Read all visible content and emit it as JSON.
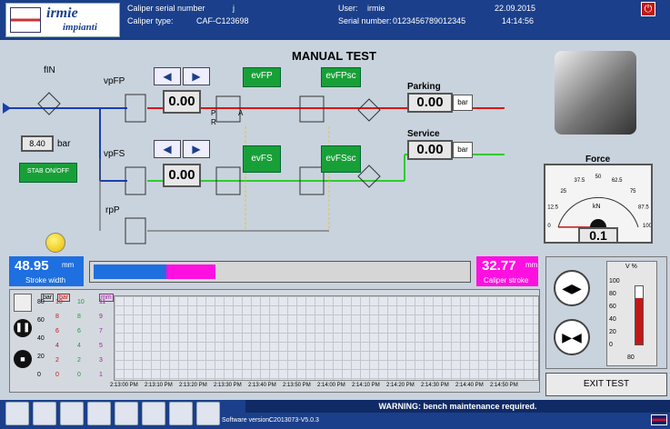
{
  "header": {
    "logo_text": "irmie",
    "logo_sub": "impianti",
    "caliper_serial_label": "Caliper serial number",
    "caliper_serial_value": "j",
    "caliper_type_label": "Caliper type:",
    "caliper_type_value": "CAF-C123698",
    "user_label": "User:",
    "user_value": "irmie",
    "serial_label": "Serial number:",
    "serial_value": "0123456789012345",
    "date": "22.09.2015",
    "time": "14:14:56"
  },
  "main": {
    "title": "MANUAL TEST",
    "fin_label": "fIN",
    "vpfp_label": "vpFP",
    "vpfs_label": "vpFS",
    "rpp_label": "rpP",
    "vpfp_value": "0.00",
    "vpfs_value": "0.00",
    "inlet_value": "8.40",
    "inlet_unit": "bar",
    "stab_button": "STAB ON/OFF",
    "evfp": "evFP",
    "evfpsc": "evFPsc",
    "evfs": "evFS",
    "evfssc": "evFSsc",
    "parking_label": "Parking",
    "parking_value": "0.00",
    "parking_unit": "bar",
    "service_label": "Service",
    "service_value": "0.00",
    "service_unit": "bar",
    "valve_p": "P",
    "valve_r": "R",
    "valve_a": "A"
  },
  "force": {
    "label": "Force",
    "ticks": [
      "0",
      "12.5",
      "25",
      "37.5",
      "50",
      "62.5",
      "75",
      "87.5",
      "100"
    ],
    "unit": "kN",
    "value": "0.1",
    "needle_fraction": 0.001
  },
  "stroke": {
    "width_value": "48.95",
    "width_unit": "mm",
    "width_label": "Stroke width",
    "caliper_value": "32.77",
    "caliper_unit": "mm",
    "caliper_label": "Caliper stroke"
  },
  "graph": {
    "axis_bar": "bar",
    "axis_bar2": "bar",
    "axis_mm": "mm",
    "y1_ticks": [
      "80",
      "60",
      "40",
      "20",
      "0"
    ],
    "y2_ticks": [
      "10",
      "8",
      "6",
      "4",
      "2",
      "0"
    ],
    "y3_ticks": [
      "10",
      "8",
      "6",
      "4",
      "2",
      "0"
    ],
    "y4_ticks": [
      "11",
      "9",
      "7",
      "5",
      "3",
      "1"
    ],
    "x_ticks": [
      "2:13:00 PM",
      "2:13:10 PM",
      "2:13:20 PM",
      "2:13:30 PM",
      "2:13:40 PM",
      "2:13:50 PM",
      "2:14:00 PM",
      "2:14:10 PM",
      "2:14:20 PM",
      "2:14:30 PM",
      "2:14:40 PM",
      "2:14:50 PM"
    ]
  },
  "gauge": {
    "unit": "V %",
    "ticks": [
      "100",
      "80",
      "60",
      "40",
      "20",
      "0"
    ],
    "value": "80",
    "level_fraction": 0.8
  },
  "exit_button": "EXIT TEST",
  "status": {
    "warning": "WARNING: bench maintenance required.",
    "software_label": "Software version:",
    "software_value": "C2013073-V5.0.3"
  },
  "colors": {
    "header": "#1b3f8a",
    "parking_line": "#d61818",
    "service_line": "#2ecc2e",
    "inlet_line": "#1b3fb0",
    "stroke_blue": "#1e6fe0",
    "stroke_magenta": "#ff10e0"
  }
}
